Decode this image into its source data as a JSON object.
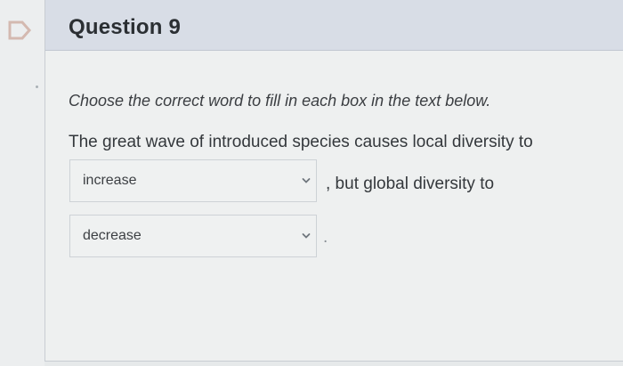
{
  "question": {
    "title": "Question 9",
    "instructions": "Choose the correct word to fill in each box in the text below.",
    "sentence_start": "The great wave of introduced species causes local diversity to",
    "sentence_mid": ", but global diversity to",
    "sentence_end": "."
  },
  "dropdowns": [
    {
      "selected": "increase"
    },
    {
      "selected": "decrease"
    }
  ]
}
